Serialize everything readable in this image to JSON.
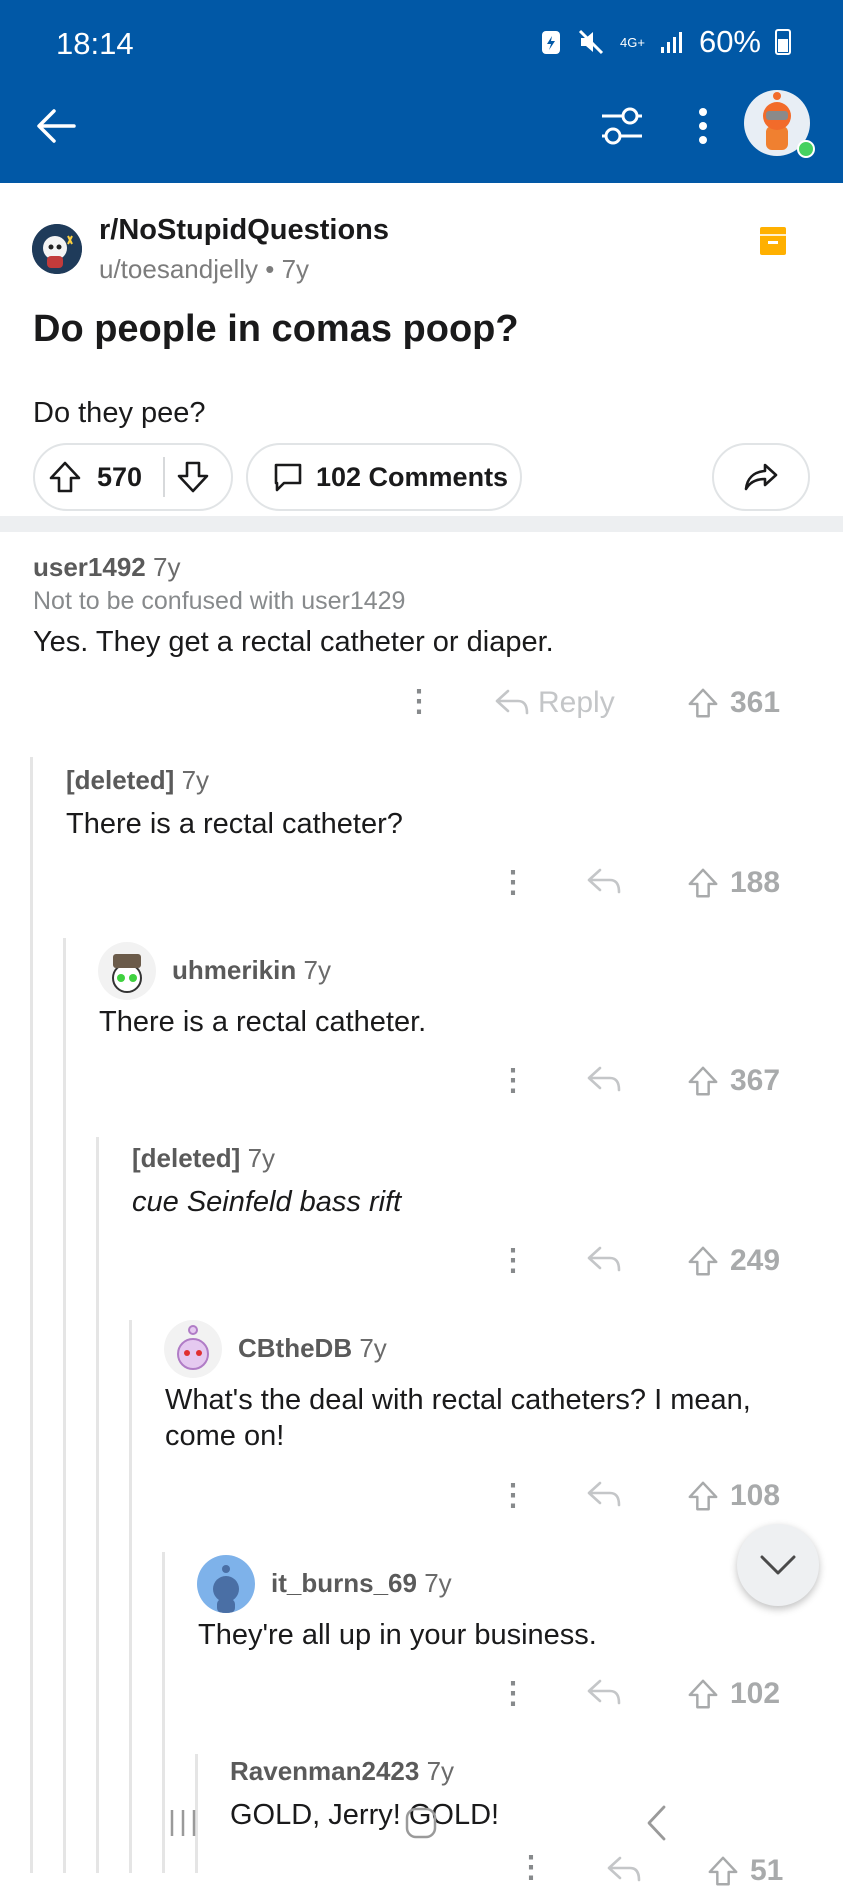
{
  "status_bar": {
    "time": "18:14",
    "network": "4G+",
    "battery": "60%"
  },
  "header": {
    "back_icon": "arrow-left-icon",
    "filter_icon": "sliders-icon",
    "more_icon": "more-vertical-icon",
    "avatar": "user-avatar"
  },
  "post": {
    "subreddit": "r/NoStupidQuestions",
    "author": "u/toesandjelly",
    "age": "7y",
    "title": "Do people in comas poop?",
    "body": "Do they pee?",
    "votes": "570",
    "comments_label": "102 Comments"
  },
  "comments": [
    {
      "author": "user1492",
      "age": "7y",
      "flair": "Not to be confused with user1429",
      "body": "Yes.  They get a rectal catheter or diaper.",
      "reply": "Reply",
      "votes": "361"
    },
    {
      "author": "[deleted]",
      "age": "7y",
      "body": "There is a rectal catheter?",
      "votes": "188"
    },
    {
      "author": "uhmerikin",
      "age": "7y",
      "body": "There is a rectal catheter.",
      "votes": "367"
    },
    {
      "author": "[deleted]",
      "age": "7y",
      "body": "cue Seinfeld bass rift",
      "votes": "249"
    },
    {
      "author": "CBtheDB",
      "age": "7y",
      "body": "What's the deal with rectal catheters? I mean, come on!",
      "votes": "108"
    },
    {
      "author": "it_burns_69",
      "age": "7y",
      "body": "They're all up in your business.",
      "votes": "102"
    },
    {
      "author": "Ravenman2423",
      "age": "7y",
      "body": "GOLD, Jerry! GOLD!",
      "votes": "51"
    }
  ],
  "colors": {
    "header_bg": "#0158a6",
    "archive_icon": "#ffb000",
    "thread_line": "#e5e5e5"
  }
}
